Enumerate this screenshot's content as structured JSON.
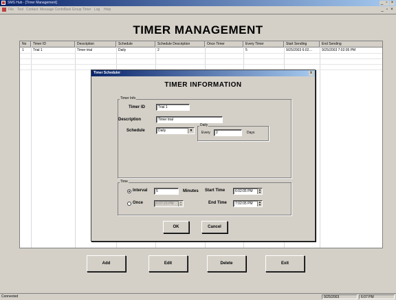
{
  "window": {
    "title": "SMS Hub - [Timer Management]"
  },
  "menu": {
    "items": [
      "File",
      "Tool",
      "Contact",
      "Message Centre",
      "Task Group",
      "Timer",
      "Log",
      "Help"
    ]
  },
  "page": {
    "title": "TIMER MANAGEMENT"
  },
  "grid": {
    "columns": [
      "No",
      "Timer ID",
      "Description",
      "Schedule",
      "Schedule Description",
      "Once Timer",
      "Every Timer",
      "Start Sending",
      "End Sending"
    ],
    "rows": [
      [
        "1",
        "Trial 1",
        "Timer trial",
        "Daily",
        "2",
        "",
        "5",
        "9/25/2003 6:02…",
        "9/25/2003 7:02:05 PM"
      ]
    ]
  },
  "dialog": {
    "title": "Timer Scheduler",
    "close": "x",
    "heading": "TIMER INFORMATION",
    "timer_info": {
      "group_label": "Timer Info",
      "timer_id_label": "Timer ID",
      "timer_id_value": "Trial 1",
      "description_label": "Description",
      "description_value": "Timer trial",
      "schedule_label": "Schedule",
      "schedule_value": "Daily",
      "daily_group_label": "Daily",
      "every_label": "Every",
      "every_value": "2",
      "days_label": "Days"
    },
    "time": {
      "group_label": "Time",
      "interval_label": "Interval",
      "interval_value": "5",
      "minutes_label": "Minutes",
      "once_label": "Once",
      "once_value": "6:07:23 PM",
      "start_time_label": "Start Time",
      "start_time_value": "6:02:05 PM",
      "end_time_label": "End Time",
      "end_time_value": "7:02:05 PM",
      "selected": "interval"
    },
    "ok_label": "OK",
    "cancel_label": "Cancel"
  },
  "buttons": {
    "add": "Add",
    "edit": "Edit",
    "delete": "Delete",
    "exit": "Exit"
  },
  "status": {
    "text": "Connected",
    "date": "9/25/2003",
    "time": "6:07 PM"
  }
}
